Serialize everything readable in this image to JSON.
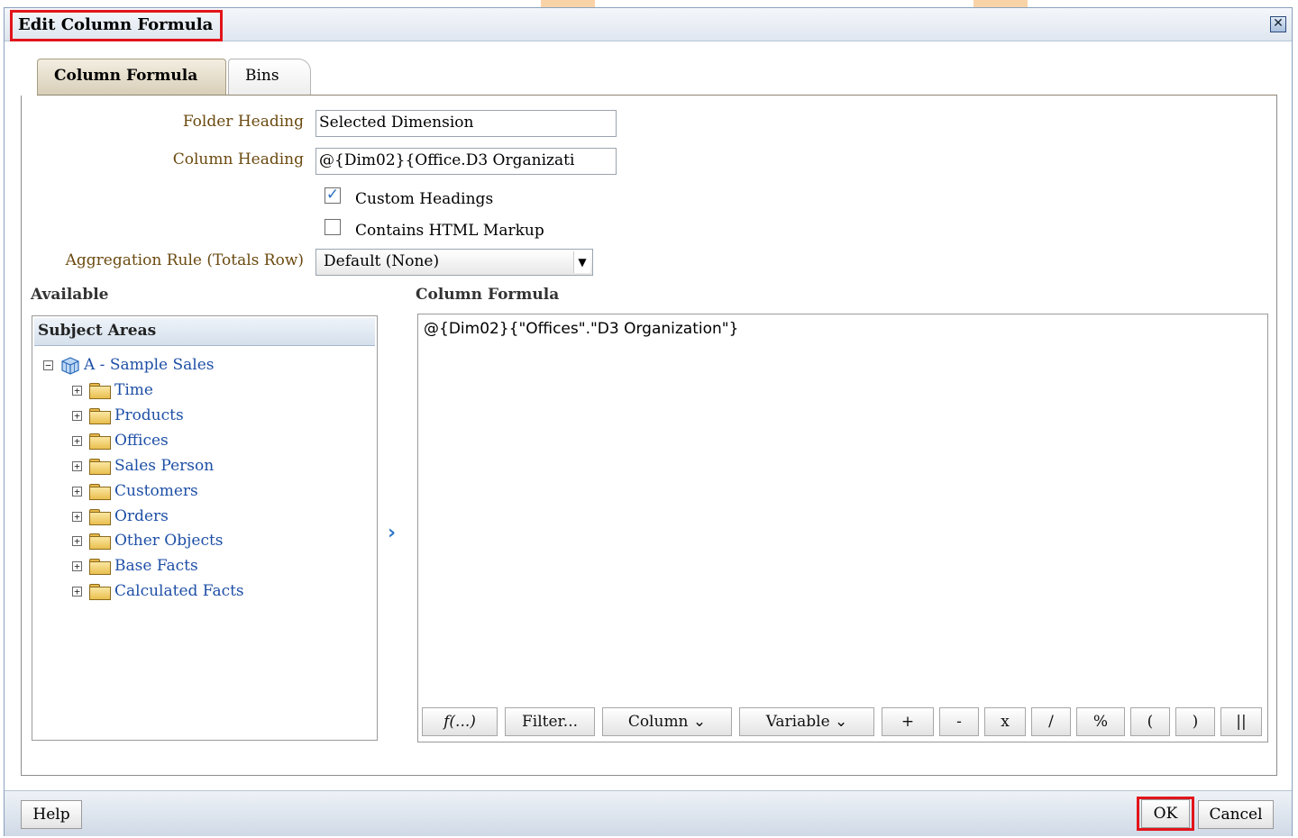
{
  "dialog": {
    "title": "Edit Column Formula",
    "close_icon": "close-x-icon"
  },
  "tabs": [
    {
      "label": "Column Formula",
      "active": true
    },
    {
      "label": "Bins",
      "active": false
    }
  ],
  "form": {
    "folder_heading_label": "Folder Heading",
    "folder_heading_value": "Selected Dimension",
    "column_heading_label": "Column Heading",
    "column_heading_value": "@{Dim02}{Office.D3  Organizati",
    "custom_headings_label": "Custom Headings",
    "custom_headings_checked": true,
    "contains_html_label": "Contains HTML Markup",
    "contains_html_checked": false,
    "aggregation_label": "Aggregation Rule (Totals Row)",
    "aggregation_value": "Default (None)"
  },
  "available": {
    "label": "Available",
    "header": "Subject Areas",
    "root": "A - Sample Sales",
    "folders": [
      "Time",
      "Products",
      "Offices",
      "Sales Person",
      "Customers",
      "Orders",
      "Other Objects",
      "Base Facts",
      "Calculated Facts"
    ]
  },
  "formula": {
    "label": "Column Formula",
    "text": "@{Dim02}{\"Offices\".\"D3  Organization\"}",
    "toolbar": [
      "f(...)",
      "Filter...",
      "Column ⌄",
      "Variable ⌄",
      "+",
      "-",
      "x",
      "/",
      "%",
      "(",
      ")",
      "||"
    ]
  },
  "footer": {
    "help": "Help",
    "ok": "OK",
    "cancel": "Cancel"
  },
  "colors": {
    "label_brown": "#6b4a10",
    "link_blue": "#1e4fa6",
    "highlight_red": "#e2141b"
  }
}
